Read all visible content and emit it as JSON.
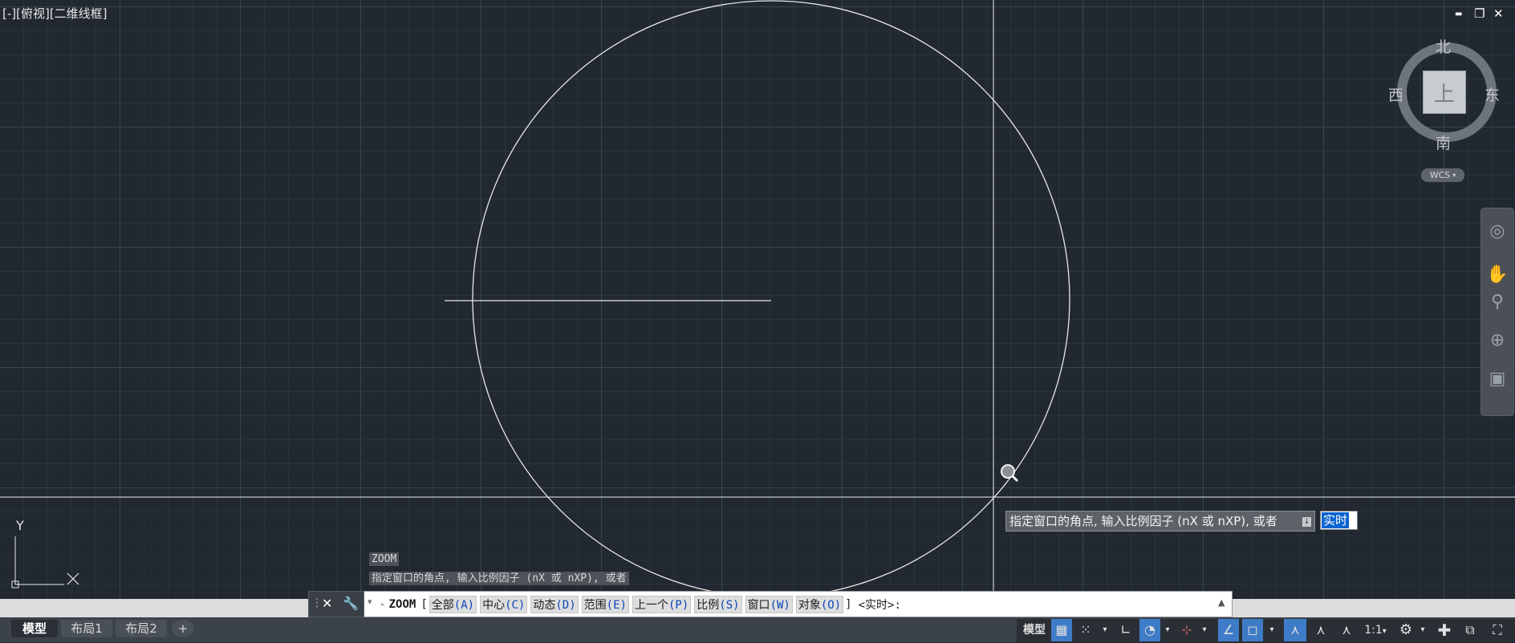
{
  "viewport": {
    "label": "[-][俯视][二维线框]",
    "window_controls": [
      "▬",
      "❐",
      "✕"
    ]
  },
  "viewcube": {
    "north": "北",
    "south": "南",
    "east": "东",
    "west": "西",
    "top_face": "上",
    "wcs_label": "WCS"
  },
  "navbar": {
    "icons": [
      "steering-wheel-icon",
      "pan-icon",
      "zoom-icon",
      "orbit-icon",
      "showmotion-icon"
    ]
  },
  "ucs": {
    "y_label": "Y"
  },
  "tooltip": {
    "prompt": "指定窗口的角点, 输入比例因子 (nX 或 nXP), 或者",
    "input_value": "实时"
  },
  "command_history": {
    "line1": "ZOOM",
    "line2": "指定窗口的角点, 输入比例因子 (nX 或 nXP), 或者"
  },
  "command_line": {
    "command": "ZOOM",
    "options": [
      {
        "label": "全部",
        "key": "(A)"
      },
      {
        "label": "中心",
        "key": "(C)"
      },
      {
        "label": "动态",
        "key": "(D)"
      },
      {
        "label": "范围",
        "key": "(E)"
      },
      {
        "label": "上一个",
        "key": "(P)"
      },
      {
        "label": "比例",
        "key": "(S)"
      },
      {
        "label": "窗口",
        "key": "(W)"
      },
      {
        "label": "对象",
        "key": "(O)"
      }
    ],
    "suffix": "<实时>:"
  },
  "tabs": {
    "model": "模型",
    "layout1": "布局1",
    "layout2": "布局2",
    "add": "+"
  },
  "statusbar": {
    "model": "模型",
    "scale": "1:1"
  },
  "colors": {
    "canvas": "#212830",
    "accent": "#3f7cc7",
    "drawing": "#ffffff"
  }
}
